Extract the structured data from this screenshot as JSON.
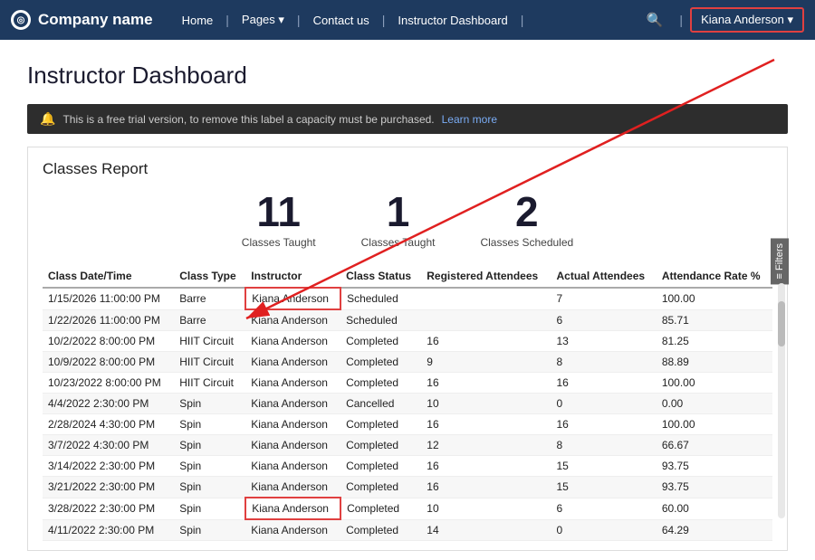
{
  "nav": {
    "brand": "Company name",
    "links": [
      "Home",
      "Pages ▾",
      "Contact us",
      "Instructor Dashboard"
    ],
    "user": "Kiana Anderson ▾",
    "search_icon": "🔍"
  },
  "banner": {
    "message": "This is a free trial version, to remove this label a capacity must be purchased.",
    "link_text": "Learn more"
  },
  "page_title": "Instructor Dashboard",
  "report": {
    "title": "Classes Report",
    "stats": [
      {
        "number": "11",
        "label": "Classes Taught"
      },
      {
        "number": "1",
        "label": "Classes Taught"
      },
      {
        "number": "2",
        "label": "Classes Scheduled"
      }
    ],
    "columns": [
      "Class Date/Time",
      "Class Type",
      "Instructor",
      "Class Status",
      "Registered Attendees",
      "Actual Attendees",
      "Attendance Rate %"
    ],
    "rows": [
      [
        "1/15/2026 11:00:00 PM",
        "Barre",
        "Kiana Anderson",
        "Scheduled",
        "",
        "7",
        "100.00"
      ],
      [
        "1/22/2026 11:00:00 PM",
        "Barre",
        "Kiana Anderson",
        "Scheduled",
        "",
        "6",
        "85.71"
      ],
      [
        "10/2/2022 8:00:00 PM",
        "HIIT Circuit",
        "Kiana Anderson",
        "Completed",
        "16",
        "13",
        "81.25"
      ],
      [
        "10/9/2022 8:00:00 PM",
        "HIIT Circuit",
        "Kiana Anderson",
        "Completed",
        "9",
        "8",
        "88.89"
      ],
      [
        "10/23/2022 8:00:00 PM",
        "HIIT Circuit",
        "Kiana Anderson",
        "Completed",
        "16",
        "16",
        "100.00"
      ],
      [
        "4/4/2022 2:30:00 PM",
        "Spin",
        "Kiana Anderson",
        "Cancelled",
        "10",
        "0",
        "0.00"
      ],
      [
        "2/28/2024 4:30:00 PM",
        "Spin",
        "Kiana Anderson",
        "Completed",
        "16",
        "16",
        "100.00"
      ],
      [
        "3/7/2022 4:30:00 PM",
        "Spin",
        "Kiana Anderson",
        "Completed",
        "12",
        "8",
        "66.67"
      ],
      [
        "3/14/2022 2:30:00 PM",
        "Spin",
        "Kiana Anderson",
        "Completed",
        "16",
        "15",
        "93.75"
      ],
      [
        "3/21/2022 2:30:00 PM",
        "Spin",
        "Kiana Anderson",
        "Completed",
        "16",
        "15",
        "93.75"
      ],
      [
        "3/28/2022 2:30:00 PM",
        "Spin",
        "Kiana Anderson",
        "Completed",
        "10",
        "6",
        "60.00"
      ],
      [
        "4/11/2022 2:30:00 PM",
        "Spin",
        "Kiana Anderson",
        "Completed",
        "14",
        "0",
        "64.29"
      ]
    ]
  },
  "filters_label": "≡ Filters"
}
